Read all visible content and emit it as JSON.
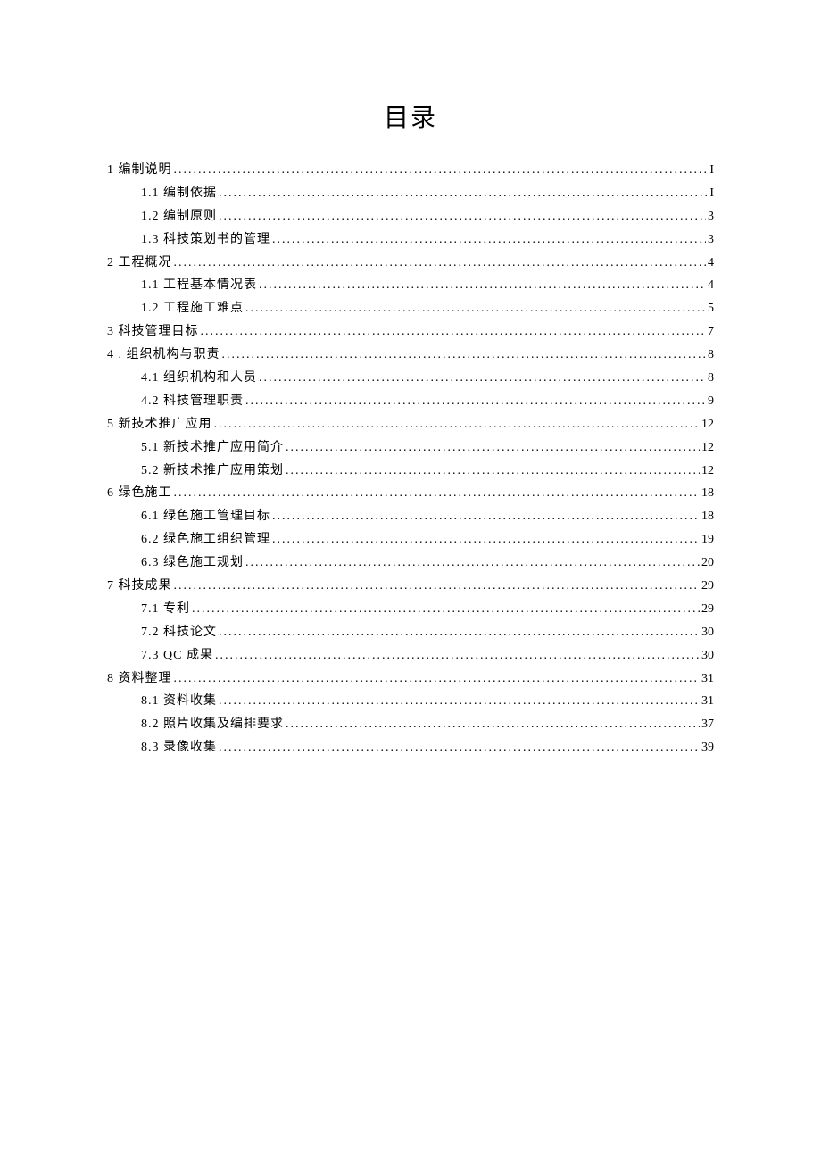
{
  "title": "目录",
  "entries": [
    {
      "level": 1,
      "label": "1 编制说明",
      "page": "I"
    },
    {
      "level": 2,
      "label": "1.1  编制依据",
      "page": "I"
    },
    {
      "level": 2,
      "label": "1.2  编制原则",
      "page": "3"
    },
    {
      "level": 2,
      "label": "1.3  科技策划书的管理",
      "page": "3"
    },
    {
      "level": 1,
      "label": "2 工程概况",
      "page": "4"
    },
    {
      "level": 2,
      "label": "1.1  工程基本情况表",
      "page": "4"
    },
    {
      "level": 2,
      "label": "1.2  工程施工难点",
      "page": "5"
    },
    {
      "level": 1,
      "label": "3 科技管理目标",
      "page": "7"
    },
    {
      "level": 1,
      "label": "4   . 组织机构与职责",
      "page": "8"
    },
    {
      "level": 2,
      "label": "4.1  组织机构和人员",
      "page": "8"
    },
    {
      "level": 2,
      "label": "4.2  科技管理职责",
      "page": "9"
    },
    {
      "level": 1,
      "label": "5   新技术推广应用",
      "page": "12"
    },
    {
      "level": 2,
      "label": "5.1  新技术推广应用简介",
      "page": "12"
    },
    {
      "level": 2,
      "label": "5.2  新技术推广应用策划",
      "page": "12"
    },
    {
      "level": 1,
      "label": "6 绿色施工",
      "page": "18"
    },
    {
      "level": 2,
      "label": "6.1  绿色施工管理目标",
      "page": "18"
    },
    {
      "level": 2,
      "label": "6.2  绿色施工组织管理",
      "page": "19"
    },
    {
      "level": 2,
      "label": "6.3  绿色施工规划",
      "page": "20"
    },
    {
      "level": 1,
      "label": "7 科技成果",
      "page": "29"
    },
    {
      "level": 2,
      "label": "7.1  专利",
      "page": "29"
    },
    {
      "level": 2,
      "label": "7.2  科技论文",
      "page": "30"
    },
    {
      "level": 2,
      "label": "7.3  QC 成果",
      "page": "30"
    },
    {
      "level": 1,
      "label": "8 资料整理",
      "page": "31"
    },
    {
      "level": 2,
      "label": "8.1  资料收集",
      "page": "31"
    },
    {
      "level": 2,
      "label": "8.2  照片收集及编排要求",
      "page": "37"
    },
    {
      "level": 2,
      "label": "8.3  录像收集",
      "page": "39"
    }
  ]
}
